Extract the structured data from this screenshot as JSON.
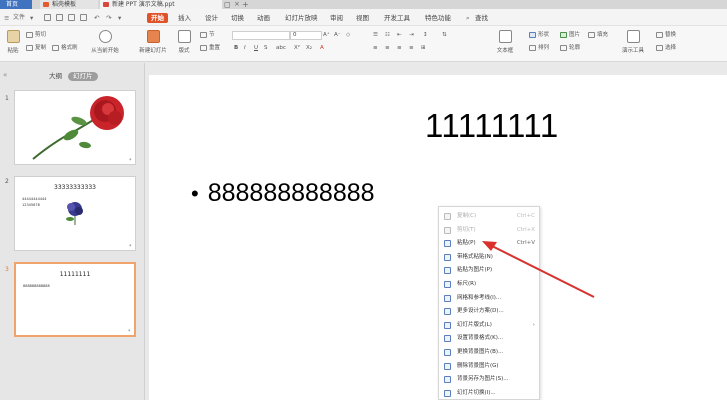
{
  "tabbar": {
    "home": "首页",
    "tab1": "稻壳模板",
    "tab2": "新建 PPT 演示文稿.ppt",
    "add": "+"
  },
  "menu": {
    "items": [
      "开始",
      "插入",
      "设计",
      "切换",
      "动画",
      "幻灯片放映",
      "审阅",
      "视图",
      "开发工具",
      "特色功能",
      "查找"
    ],
    "active": "开始"
  },
  "ribbon": {
    "paste": "粘贴",
    "cut": "剪切",
    "copy": "复制",
    "format_painter": "格式刷",
    "from_current": "从当前开始",
    "new_slide": "新建幻灯片",
    "layout": "版式",
    "section": "节",
    "reset": "重置",
    "font_size": "0",
    "textbox": "文本框",
    "shape": "形状",
    "arrange": "排列",
    "picture": "图片",
    "fill": "填充",
    "outline": "轮廓",
    "presenter_tools": "演示工具",
    "replace": "替换",
    "select": "选择"
  },
  "leftpane": {
    "outline_tab": "大纲",
    "slides_tab": "幻灯片",
    "slides": [
      {
        "num": "1"
      },
      {
        "num": "2",
        "title": "33333333333",
        "lines": [
          "44444444444",
          "12345678"
        ]
      },
      {
        "num": "3",
        "title": "11111111",
        "lines": [
          "888888888888"
        ]
      }
    ]
  },
  "slide": {
    "title": "11111111",
    "bullet": "888888888888"
  },
  "context_menu": [
    {
      "label": "复制(C)",
      "shortcut": "Ctrl+C",
      "disabled": true,
      "icon": "copy-icon"
    },
    {
      "label": "剪切(T)",
      "shortcut": "Ctrl+X",
      "disabled": true,
      "icon": "cut-icon"
    },
    {
      "label": "粘贴(P)",
      "shortcut": "Ctrl+V",
      "disabled": false,
      "icon": "paste-icon"
    },
    {
      "label": "带格式粘贴(N)",
      "shortcut": "",
      "disabled": false,
      "icon": "paste-format-icon"
    },
    {
      "label": "粘贴为图片(P)",
      "shortcut": "",
      "disabled": false,
      "icon": "paste-picture-icon"
    },
    {
      "label": "标尺(R)",
      "shortcut": "",
      "disabled": false,
      "icon": "ruler-icon"
    },
    {
      "label": "网格和参考线(I)...",
      "shortcut": "",
      "disabled": false,
      "icon": "grid-icon"
    },
    {
      "label": "更多设计方案(D)...",
      "shortcut": "",
      "disabled": false,
      "icon": "design-icon"
    },
    {
      "label": "幻灯片版式(L)",
      "shortcut": "›",
      "disabled": false,
      "icon": "layout-icon"
    },
    {
      "label": "设置背景格式(K)...",
      "shortcut": "",
      "disabled": false,
      "icon": "background-format-icon"
    },
    {
      "label": "更换背景图片(B)...",
      "shortcut": "",
      "disabled": false,
      "icon": "change-bg-icon"
    },
    {
      "label": "删除背景图片(G)",
      "shortcut": "",
      "disabled": false,
      "icon": "delete-bg-icon"
    },
    {
      "label": "背景另存为图片(S)...",
      "shortcut": "",
      "disabled": false,
      "icon": "save-bg-icon"
    },
    {
      "label": "幻灯片切换(I)...",
      "shortcut": "",
      "disabled": false,
      "icon": "transition-icon"
    }
  ],
  "colors": {
    "accent": "#e05328",
    "home_tab": "#3f73c0",
    "annotation_arrow": "#d9302b",
    "selected_thumb_border": "#f0a36b"
  }
}
